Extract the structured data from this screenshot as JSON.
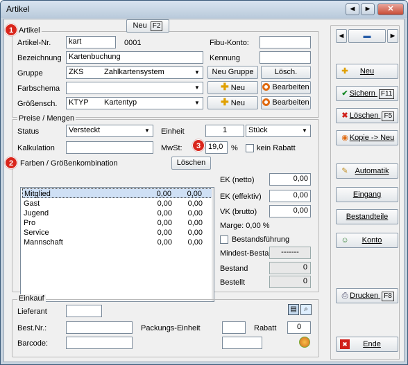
{
  "window": {
    "title": "Artikel",
    "controls": [
      "◄",
      "►",
      "✕"
    ]
  },
  "artikel": {
    "group_title": "Artikel",
    "artikel_nr_label": "Artikel-Nr.",
    "artikel_nr": "kart",
    "artikel_nr_num": "0001",
    "fibu_label": "Fibu-Konto:",
    "fibu_value": "",
    "bezeichnung_label": "Bezeichnung",
    "bezeichnung": "Kartenbuchung",
    "kennung_label": "Kennung",
    "kennung_value": "",
    "gruppe_label": "Gruppe",
    "gruppe_code": "ZKS",
    "gruppe_name": "Zahlkartensystem",
    "neu_gruppe": "Neu Gruppe",
    "loesch": "Lösch.",
    "farbschema_label": "Farbschema",
    "farbschema_value": "",
    "groessensch_label": "Größensch.",
    "groessensch_code": "KTYP",
    "groessensch_name": "Kartentyp",
    "neu": "Neu",
    "bearbeiten": "Bearbeiten"
  },
  "preise": {
    "group_title": "Preise / Mengen",
    "status_label": "Status",
    "status_value": "Versteckt",
    "einheit_label": "Einheit",
    "einheit_qty": "1",
    "einheit_value": "Stück",
    "kalkulation_label": "Kalkulation",
    "kalkulation_value": "",
    "mwst_label": "MwSt:",
    "mwst_value": "19,0",
    "mwst_unit": "%",
    "kein_rabatt": "kein Rabatt",
    "farben_label": "Farben / Größenkombination",
    "farben_neu": "Neu",
    "farben_neu_key": "F2",
    "farben_loeschen": "Löschen",
    "rows": [
      {
        "name": "Mitglied",
        "a": "0,00",
        "b": "0,00"
      },
      {
        "name": "Gast",
        "a": "0,00",
        "b": "0,00"
      },
      {
        "name": "Jugend",
        "a": "0,00",
        "b": "0,00"
      },
      {
        "name": "Pro",
        "a": "0,00",
        "b": "0,00"
      },
      {
        "name": "Service",
        "a": "0,00",
        "b": "0,00"
      },
      {
        "name": "Mannschaft",
        "a": "0,00",
        "b": "0,00"
      }
    ],
    "ek_netto_label": "EK (netto)",
    "ek_netto": "0,00",
    "ek_eff_label": "EK (effektiv)",
    "ek_eff": "0,00",
    "vk_brutto_label": "VK (brutto)",
    "vk_brutto": "0,00",
    "marge": "Marge: 0,00 %",
    "bestandsfuehrung": "Bestandsführung",
    "mindest_label": "Mindest-Bestand",
    "mindest_value": "-------",
    "bestand_label": "Bestand",
    "bestand_value": "0",
    "bestellt_label": "Bestellt",
    "bestellt_value": "0"
  },
  "einkauf": {
    "group_title": "Einkauf",
    "lieferant_label": "Lieferant",
    "lieferant_value": "",
    "bestnr_label": "Best.Nr.:",
    "bestnr_value": "",
    "packungs_label": "Packungs-Einheit",
    "packungs_value": "",
    "rabatt_label": "Rabatt",
    "rabatt_value": "0",
    "barcode_label": "Barcode:",
    "barcode_value": "",
    "barcode_value2": ""
  },
  "sidebar": {
    "neu": "Neu",
    "sichern": "Sichern",
    "sichern_key": "F11",
    "loeschen": "Löschen",
    "loeschen_key": "F5",
    "kopie": "Kopie -> Neu",
    "automatik": "Automatik",
    "eingang": "Eingang",
    "bestandteile": "Bestandteile",
    "konto": "Konto",
    "drucken": "Drucken",
    "drucken_key": "F8",
    "ende": "Ende"
  },
  "badges": [
    "1",
    "2",
    "3"
  ]
}
